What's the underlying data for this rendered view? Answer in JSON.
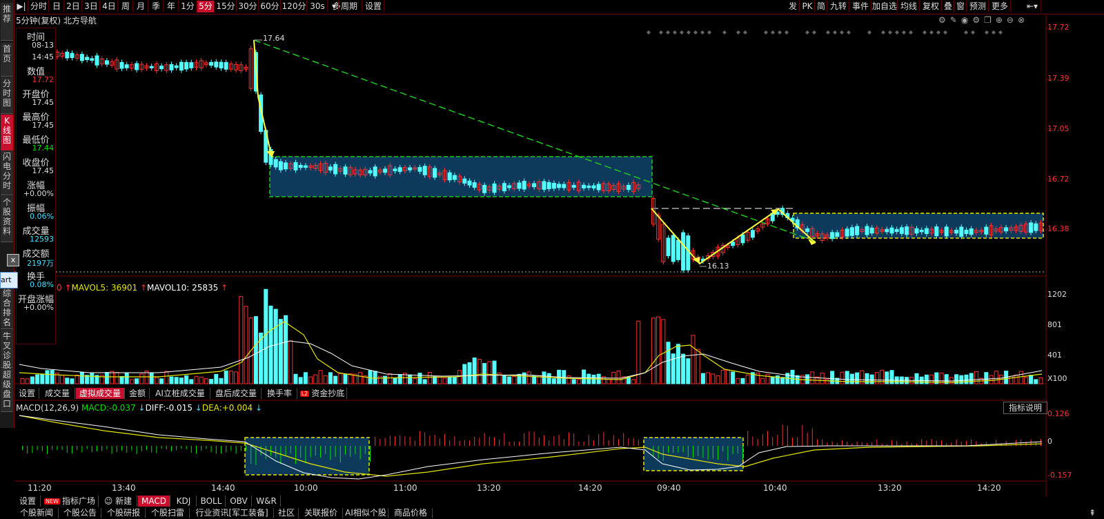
{
  "toolbar": {
    "items": [
      "分时",
      "日",
      "2日",
      "3日",
      "4日",
      "周",
      "月",
      "季",
      "年",
      "1分",
      "5分",
      "15分",
      "30分",
      "60分",
      "120分",
      "30s",
      "多周期",
      "设置"
    ],
    "active_index": 10,
    "right_items": [
      "发",
      "PK",
      "简",
      "九转",
      "事件",
      "加自选",
      "均线",
      "复权",
      "叠",
      "窗",
      "预测",
      "更多"
    ]
  },
  "left_nav": [
    "推荐",
    "首页",
    "分时图",
    "K线图",
    "闪电分时",
    "个股资料",
    "综合排名",
    "牛叉诊股",
    "超级盘口"
  ],
  "left_nav_active": 3,
  "chart_title": "5分钟(复权)  北方导航",
  "info_panel": {
    "rows": [
      {
        "label": "时间",
        "value": "08-13",
        "value2": "14:45",
        "color": "#dddddd"
      },
      {
        "label": "数值",
        "value": "17.72",
        "color": "#ff3030"
      },
      {
        "label": "开盘价",
        "value": "17.45",
        "color": "#dddddd"
      },
      {
        "label": "最高价",
        "value": "17.45",
        "color": "#dddddd"
      },
      {
        "label": "最低价",
        "value": "17.44",
        "color": "#00e000"
      },
      {
        "label": "收盘价",
        "value": "17.45",
        "color": "#dddddd"
      },
      {
        "label": "涨幅",
        "value": "+0.00%",
        "color": "#dddddd"
      },
      {
        "label": "振幅",
        "value": "0.06%",
        "color": "#40e0ff"
      },
      {
        "label": "成交量",
        "value": "12593",
        "color": "#40e0ff"
      },
      {
        "label": "成交额",
        "value": "2197万",
        "color": "#40e0ff"
      },
      {
        "label": "换手",
        "value": "0.08%",
        "color": "#40e0ff"
      },
      {
        "label": "开盘涨幅",
        "value": "+0.00%",
        "color": "#dddddd"
      }
    ]
  },
  "popup": {
    "close": "x",
    "button": "art"
  },
  "price_axis": [
    "17.72",
    "17.39",
    "17.05",
    "16.72",
    "16.38"
  ],
  "annotations": {
    "high": "17.64",
    "low": "16.13"
  },
  "volume_legend": {
    "prefix": "0",
    "mavol5_label": "MAVOL5:",
    "mavol5": "36901",
    "mavol10_label": "MAVOL10:",
    "mavol10": "25835"
  },
  "volume_axis": [
    "1202",
    "801",
    "401",
    "X100"
  ],
  "volume_tabs": [
    "设置",
    "成交量",
    "虚拟成交量",
    "金额",
    "AI立桩成交量",
    "盘后成交量",
    "换手率",
    "资金抄底"
  ],
  "volume_tabs_active": 2,
  "macd_legend": {
    "name": "MACD(12,26,9)",
    "macd_label": "MACD:",
    "macd": "-0.037",
    "diff_label": "DIFF:",
    "diff": "-0.015",
    "dea_label": "DEA:",
    "dea": "+0.004"
  },
  "macd_help": "指标说明",
  "macd_axis": [
    "0.126",
    "0",
    "-0.157"
  ],
  "time_axis": [
    "11:20",
    "13:40",
    "14:40",
    "10:00",
    "11:00",
    "13:20",
    "14:20",
    "09:40",
    "10:40",
    "13:20",
    "14:20"
  ],
  "indicator_tabs": [
    "设置",
    "指标广场",
    "新建",
    "MACD",
    "KDJ",
    "BOLL",
    "OBV",
    "W&R"
  ],
  "indicator_new_badge": "NEW",
  "indicator_active": 3,
  "bottom_tabs": [
    "个股新闻",
    "个股公告",
    "个股研报",
    "个股扫雷",
    "行业资讯[军工装备]",
    "社区",
    "关联报价",
    "AI相似个股",
    "商品价格"
  ],
  "colors": {
    "up": "#ff3030",
    "down": "#54ffff",
    "box": "#0d3a5a",
    "accent": "#c8102e",
    "mavol5": "#e6e600",
    "mavol10": "#ffffff"
  }
}
